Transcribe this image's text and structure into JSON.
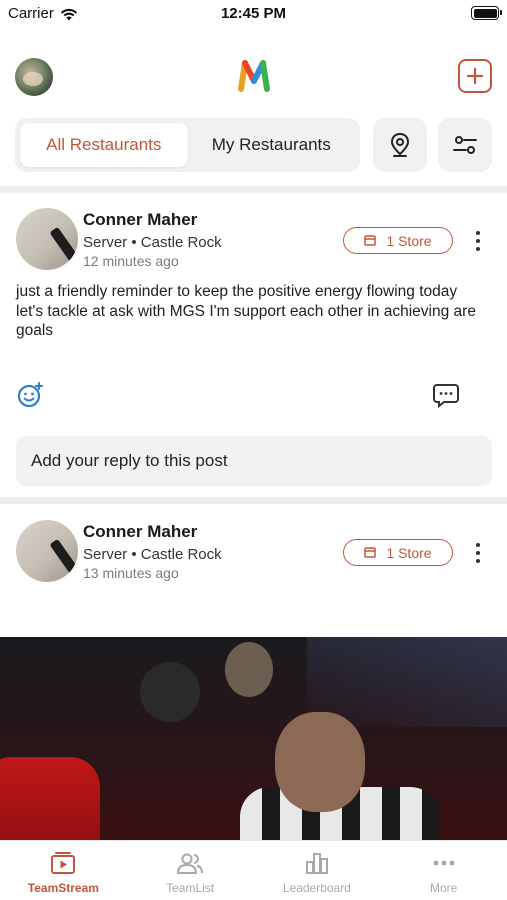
{
  "status_bar": {
    "carrier": "Carrier",
    "time": "12:45 PM"
  },
  "header": {
    "logo_icon": "m-logo-icon",
    "add_icon": "plus-square-icon"
  },
  "tabs": {
    "all_restaurants": "All Restaurants",
    "my_restaurants": "My Restaurants",
    "active": "all_restaurants"
  },
  "posts": [
    {
      "author": "Conner Maher",
      "role": "Server • Castle Rock",
      "time": "12 minutes ago",
      "store_badge": "1 Store",
      "body": "just a friendly reminder to keep the positive energy flowing today let's tackle at ask with MGS I'm support each other in achieving are goals",
      "reply_placeholder": "Add your reply to this post"
    },
    {
      "author": "Conner Maher",
      "role": "Server • Castle Rock",
      "time": "13 minutes ago",
      "store_badge": "1 Store"
    }
  ],
  "bottom_nav": [
    {
      "label": "TeamStream",
      "icon": "teamstream-icon",
      "active": true
    },
    {
      "label": "TeamList",
      "icon": "people-icon",
      "active": false
    },
    {
      "label": "Leaderboard",
      "icon": "bar-chart-icon",
      "active": false
    },
    {
      "label": "More",
      "icon": "more-dots-icon",
      "active": false
    }
  ],
  "colors": {
    "accent": "#c0573c",
    "inactive": "#a9a9a9",
    "surface": "#f1f1f1"
  }
}
